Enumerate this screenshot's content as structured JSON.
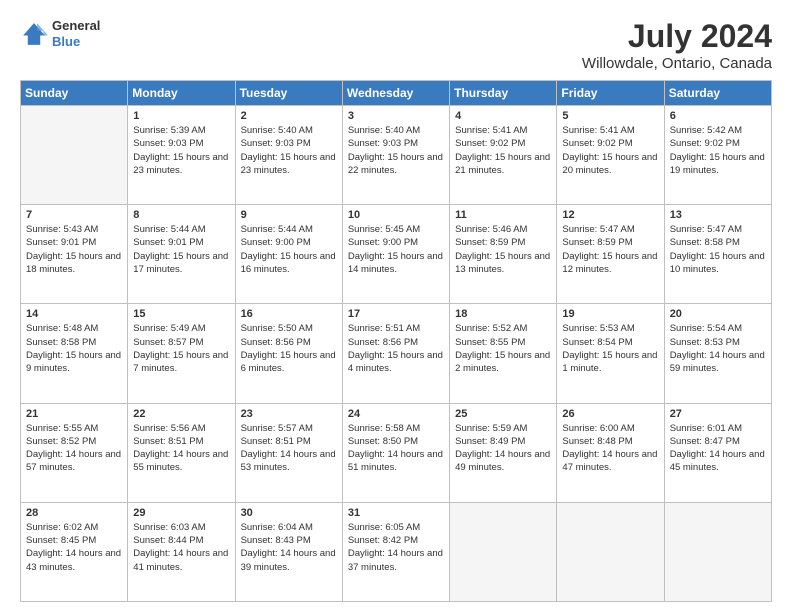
{
  "logo": {
    "general": "General",
    "blue": "Blue"
  },
  "title": "July 2024",
  "subtitle": "Willowdale, Ontario, Canada",
  "days_header": [
    "Sunday",
    "Monday",
    "Tuesday",
    "Wednesday",
    "Thursday",
    "Friday",
    "Saturday"
  ],
  "weeks": [
    [
      {
        "day": "",
        "empty": true
      },
      {
        "day": "1",
        "sunrise": "Sunrise: 5:39 AM",
        "sunset": "Sunset: 9:03 PM",
        "daylight": "Daylight: 15 hours and 23 minutes."
      },
      {
        "day": "2",
        "sunrise": "Sunrise: 5:40 AM",
        "sunset": "Sunset: 9:03 PM",
        "daylight": "Daylight: 15 hours and 23 minutes."
      },
      {
        "day": "3",
        "sunrise": "Sunrise: 5:40 AM",
        "sunset": "Sunset: 9:03 PM",
        "daylight": "Daylight: 15 hours and 22 minutes."
      },
      {
        "day": "4",
        "sunrise": "Sunrise: 5:41 AM",
        "sunset": "Sunset: 9:02 PM",
        "daylight": "Daylight: 15 hours and 21 minutes."
      },
      {
        "day": "5",
        "sunrise": "Sunrise: 5:41 AM",
        "sunset": "Sunset: 9:02 PM",
        "daylight": "Daylight: 15 hours and 20 minutes."
      },
      {
        "day": "6",
        "sunrise": "Sunrise: 5:42 AM",
        "sunset": "Sunset: 9:02 PM",
        "daylight": "Daylight: 15 hours and 19 minutes."
      }
    ],
    [
      {
        "day": "7",
        "sunrise": "Sunrise: 5:43 AM",
        "sunset": "Sunset: 9:01 PM",
        "daylight": "Daylight: 15 hours and 18 minutes."
      },
      {
        "day": "8",
        "sunrise": "Sunrise: 5:44 AM",
        "sunset": "Sunset: 9:01 PM",
        "daylight": "Daylight: 15 hours and 17 minutes."
      },
      {
        "day": "9",
        "sunrise": "Sunrise: 5:44 AM",
        "sunset": "Sunset: 9:00 PM",
        "daylight": "Daylight: 15 hours and 16 minutes."
      },
      {
        "day": "10",
        "sunrise": "Sunrise: 5:45 AM",
        "sunset": "Sunset: 9:00 PM",
        "daylight": "Daylight: 15 hours and 14 minutes."
      },
      {
        "day": "11",
        "sunrise": "Sunrise: 5:46 AM",
        "sunset": "Sunset: 8:59 PM",
        "daylight": "Daylight: 15 hours and 13 minutes."
      },
      {
        "day": "12",
        "sunrise": "Sunrise: 5:47 AM",
        "sunset": "Sunset: 8:59 PM",
        "daylight": "Daylight: 15 hours and 12 minutes."
      },
      {
        "day": "13",
        "sunrise": "Sunrise: 5:47 AM",
        "sunset": "Sunset: 8:58 PM",
        "daylight": "Daylight: 15 hours and 10 minutes."
      }
    ],
    [
      {
        "day": "14",
        "sunrise": "Sunrise: 5:48 AM",
        "sunset": "Sunset: 8:58 PM",
        "daylight": "Daylight: 15 hours and 9 minutes."
      },
      {
        "day": "15",
        "sunrise": "Sunrise: 5:49 AM",
        "sunset": "Sunset: 8:57 PM",
        "daylight": "Daylight: 15 hours and 7 minutes."
      },
      {
        "day": "16",
        "sunrise": "Sunrise: 5:50 AM",
        "sunset": "Sunset: 8:56 PM",
        "daylight": "Daylight: 15 hours and 6 minutes."
      },
      {
        "day": "17",
        "sunrise": "Sunrise: 5:51 AM",
        "sunset": "Sunset: 8:56 PM",
        "daylight": "Daylight: 15 hours and 4 minutes."
      },
      {
        "day": "18",
        "sunrise": "Sunrise: 5:52 AM",
        "sunset": "Sunset: 8:55 PM",
        "daylight": "Daylight: 15 hours and 2 minutes."
      },
      {
        "day": "19",
        "sunrise": "Sunrise: 5:53 AM",
        "sunset": "Sunset: 8:54 PM",
        "daylight": "Daylight: 15 hours and 1 minute."
      },
      {
        "day": "20",
        "sunrise": "Sunrise: 5:54 AM",
        "sunset": "Sunset: 8:53 PM",
        "daylight": "Daylight: 14 hours and 59 minutes."
      }
    ],
    [
      {
        "day": "21",
        "sunrise": "Sunrise: 5:55 AM",
        "sunset": "Sunset: 8:52 PM",
        "daylight": "Daylight: 14 hours and 57 minutes."
      },
      {
        "day": "22",
        "sunrise": "Sunrise: 5:56 AM",
        "sunset": "Sunset: 8:51 PM",
        "daylight": "Daylight: 14 hours and 55 minutes."
      },
      {
        "day": "23",
        "sunrise": "Sunrise: 5:57 AM",
        "sunset": "Sunset: 8:51 PM",
        "daylight": "Daylight: 14 hours and 53 minutes."
      },
      {
        "day": "24",
        "sunrise": "Sunrise: 5:58 AM",
        "sunset": "Sunset: 8:50 PM",
        "daylight": "Daylight: 14 hours and 51 minutes."
      },
      {
        "day": "25",
        "sunrise": "Sunrise: 5:59 AM",
        "sunset": "Sunset: 8:49 PM",
        "daylight": "Daylight: 14 hours and 49 minutes."
      },
      {
        "day": "26",
        "sunrise": "Sunrise: 6:00 AM",
        "sunset": "Sunset: 8:48 PM",
        "daylight": "Daylight: 14 hours and 47 minutes."
      },
      {
        "day": "27",
        "sunrise": "Sunrise: 6:01 AM",
        "sunset": "Sunset: 8:47 PM",
        "daylight": "Daylight: 14 hours and 45 minutes."
      }
    ],
    [
      {
        "day": "28",
        "sunrise": "Sunrise: 6:02 AM",
        "sunset": "Sunset: 8:45 PM",
        "daylight": "Daylight: 14 hours and 43 minutes."
      },
      {
        "day": "29",
        "sunrise": "Sunrise: 6:03 AM",
        "sunset": "Sunset: 8:44 PM",
        "daylight": "Daylight: 14 hours and 41 minutes."
      },
      {
        "day": "30",
        "sunrise": "Sunrise: 6:04 AM",
        "sunset": "Sunset: 8:43 PM",
        "daylight": "Daylight: 14 hours and 39 minutes."
      },
      {
        "day": "31",
        "sunrise": "Sunrise: 6:05 AM",
        "sunset": "Sunset: 8:42 PM",
        "daylight": "Daylight: 14 hours and 37 minutes."
      },
      {
        "day": "",
        "empty": true
      },
      {
        "day": "",
        "empty": true
      },
      {
        "day": "",
        "empty": true
      }
    ]
  ]
}
